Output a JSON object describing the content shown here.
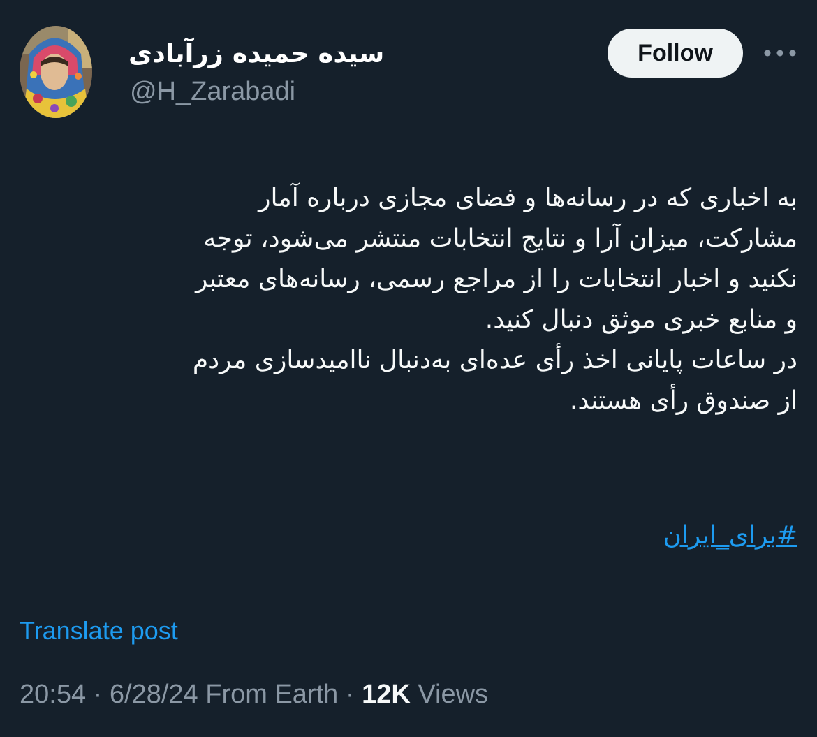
{
  "author": {
    "display_name": "سیده حمیده زرآبادی",
    "handle": "@H_Zarabadi"
  },
  "header": {
    "follow_label": "Follow",
    "more_icon": "more-horizontal-icon"
  },
  "tweet": {
    "lines": [
      "به اخباری که در رسانه‌ها و فضای مجازی درباره آمار",
      "مشارکت، میزان آرا و نتایج انتخابات منتشر می‌شود، توجه",
      "نکنید و اخبار انتخابات را از مراجع رسمی، رسانه‌های معتبر",
      "و منابع خبری موثق دنبال کنید.",
      "در ساعات پایانی اخذ رأی عده‌ای به‌دنبال ناامیدسازی مردم",
      "از صندوق رأی هستند."
    ],
    "hashtag": "#برای_ایران"
  },
  "footer": {
    "translate_label": "Translate post",
    "time": "20:54",
    "separator": "·",
    "date": "6/28/24",
    "source": "From Earth",
    "views_count": "12K",
    "views_label": "Views"
  },
  "colors": {
    "background": "#15202b",
    "accent": "#1d9bf0",
    "secondary_text": "#8b98a5",
    "follow_bg": "#eff3f4"
  }
}
